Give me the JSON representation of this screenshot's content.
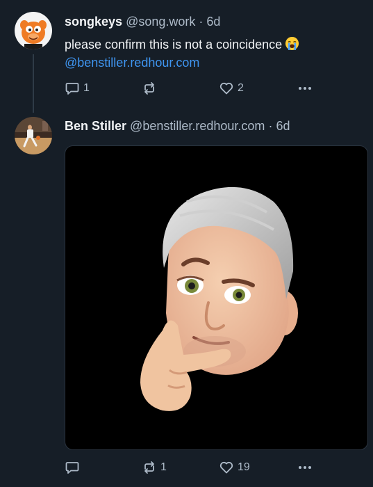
{
  "post1": {
    "author": "songkeys",
    "handle": "@song.work",
    "separator": "·",
    "time": "6d",
    "text": "please confirm this is not a coincidence",
    "emoji": "loudly-crying-face",
    "mention": "@benstiller.redhour.com",
    "replies": "1",
    "reposts": "",
    "likes": "2",
    "avatar": "orange-cartoon-character"
  },
  "post2": {
    "author": "Ben Stiller",
    "handle": "@benstiller.redhour.com",
    "separator": "·",
    "time": "6d",
    "image": "memoji-thinking-face",
    "replies": "",
    "reposts": "1",
    "likes": "19",
    "avatar": "basketball-player-photo"
  },
  "colors": {
    "background": "#161e27",
    "accent_link": "#3f95f0",
    "muted_text": "#aebbc9"
  }
}
